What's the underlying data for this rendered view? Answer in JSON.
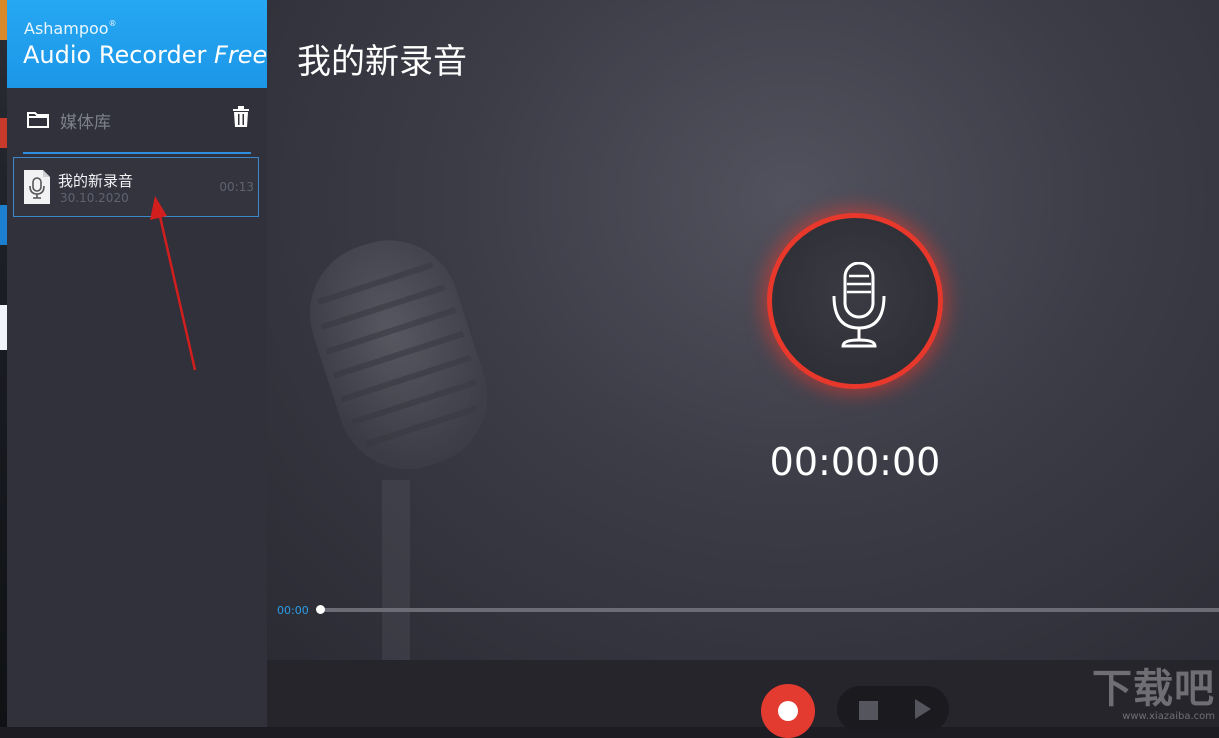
{
  "brand": {
    "vendor": "Ashampoo",
    "reg": "®",
    "product": "Audio Recorder",
    "edition": "Free"
  },
  "library": {
    "label": "媒体库"
  },
  "recordings": [
    {
      "name": "我的新录音",
      "date": "30.10.2020",
      "duration": "00:13"
    }
  ],
  "main": {
    "title": "我的新录音",
    "timer": "00:00:00",
    "seek_time": "00:00",
    "progress": 0
  },
  "watermark": {
    "main": "下载吧",
    "sub": "www.xiazaiba.com"
  },
  "colors": {
    "brand_blue": "#1c96e8",
    "record_red": "#e43b30",
    "accent_blue": "#2d9ee8"
  }
}
